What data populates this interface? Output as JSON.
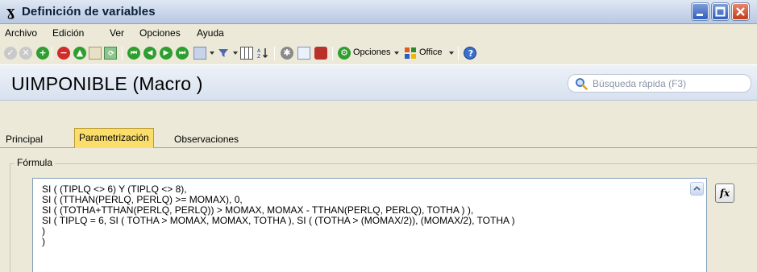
{
  "window": {
    "title": "Definición de variables",
    "minimize_label": "",
    "maximize_label": "",
    "close_label": ""
  },
  "menu": {
    "items": [
      {
        "label": "Archivo"
      },
      {
        "label": "Edición"
      },
      {
        "label": "Ver"
      },
      {
        "label": "Opciones"
      },
      {
        "label": "Ayuda"
      }
    ]
  },
  "toolbar": {
    "opciones_label": "Opciones",
    "office_label": "Office",
    "icons": [
      "accept-icon",
      "cancel-icon",
      "add-icon",
      "delete-icon",
      "up-icon",
      "notes-icon",
      "refresh-icon",
      "first-icon",
      "previous-icon",
      "next-icon",
      "last-icon",
      "search-records-icon",
      "filter-icon",
      "columns-icon",
      "sort-icon",
      "tools-icon",
      "preview-icon",
      "print-icon",
      "options-icon",
      "office-icon",
      "help-icon"
    ],
    "colors": {
      "green": "#2e9e2e",
      "red": "#d22b2b",
      "grey": "#b9b9b9"
    }
  },
  "header": {
    "page_title": "UIMPONIBLE (Macro )",
    "search_placeholder": "Búsqueda rápida (F3)"
  },
  "tabs": [
    {
      "label": "Principal",
      "active": false
    },
    {
      "label": "Parametrización",
      "active": true
    },
    {
      "label": "Observaciones",
      "active": false
    }
  ],
  "formula": {
    "legend": "Fórmula",
    "button_label": "fx",
    "lines": [
      "SI ( (TIPLQ <> 6) Y (TIPLQ <> 8),",
      "SI ( (TTHAN(PERLQ, PERLQ) >= MOMAX), 0,",
      "SI ( (TOTHA+TTHAN(PERLQ, PERLQ)) > MOMAX, MOMAX - TTHAN(PERLQ, PERLQ), TOTHA ) ),",
      "SI ( TIPLQ = 6, SI ( TOTHA > MOMAX, MOMAX, TOTHA ), SI ( (TOTHA > (MOMAX/2)), (MOMAX/2), TOTHA )",
      ")",
      ")"
    ]
  }
}
